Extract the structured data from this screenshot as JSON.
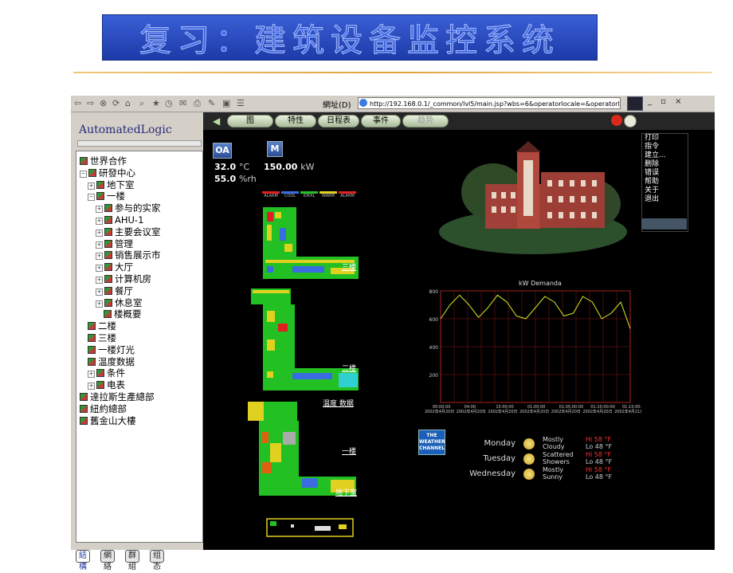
{
  "slide": {
    "title": "复习：建筑设备监控系统"
  },
  "browser": {
    "address_label": "網址(D)",
    "url": "http://192.168.0.1/_common/lvl5/main.jsp?wbs=6&operatorlocale=&operatorlanguage=ch",
    "window_controls": "_ ▫ ×"
  },
  "sidebar": {
    "logo": "AutomatedLogic",
    "tree": [
      {
        "label": "世界合作",
        "level": 0,
        "toggle": ""
      },
      {
        "label": "研發中心",
        "level": 0,
        "toggle": "−"
      },
      {
        "label": "地下室",
        "level": 1,
        "toggle": "+"
      },
      {
        "label": "一楼",
        "level": 1,
        "toggle": "−"
      },
      {
        "label": "参与的实家",
        "level": 2,
        "toggle": "+"
      },
      {
        "label": "AHU-1",
        "level": 2,
        "toggle": "+"
      },
      {
        "label": "主要会议室",
        "level": 2,
        "toggle": "+"
      },
      {
        "label": "管理",
        "level": 2,
        "toggle": "+"
      },
      {
        "label": "销售展示市",
        "level": 2,
        "toggle": "+"
      },
      {
        "label": "大厅",
        "level": 2,
        "toggle": "+"
      },
      {
        "label": "计算机房",
        "level": 2,
        "toggle": "+"
      },
      {
        "label": "餐厅",
        "level": 2,
        "toggle": "+"
      },
      {
        "label": "休息室",
        "level": 2,
        "toggle": "+"
      },
      {
        "label": "楼概要",
        "level": 3,
        "toggle": ""
      },
      {
        "label": "二楼",
        "level": 1,
        "toggle": ""
      },
      {
        "label": "三楼",
        "level": 1,
        "toggle": ""
      },
      {
        "label": "一楼灯光",
        "level": 1,
        "toggle": ""
      },
      {
        "label": "温度数据",
        "level": 1,
        "toggle": ""
      },
      {
        "label": "条件",
        "level": 1,
        "toggle": "+"
      },
      {
        "label": "电表",
        "level": 1,
        "toggle": "+"
      },
      {
        "label": "達拉斯生產總部",
        "level": 0,
        "toggle": ""
      },
      {
        "label": "紐約總部",
        "level": 0,
        "toggle": ""
      },
      {
        "label": "舊金山大樓",
        "level": 0,
        "toggle": ""
      }
    ],
    "tabs": [
      "結構",
      "網絡",
      "群組",
      "组态"
    ]
  },
  "navbar": {
    "buttons": [
      "图",
      "特性",
      "日程表",
      "事件",
      "趋势"
    ]
  },
  "menu": {
    "items": [
      "打印",
      "指令",
      "建立...",
      "删除",
      "错误",
      "帮助",
      "关于",
      "退出"
    ]
  },
  "readouts": {
    "oa_label": "OA",
    "m_label": "M",
    "temp_value": "32.0",
    "temp_unit": "°C",
    "kw_value": "150.00",
    "kw_unit": "kW",
    "rh_value": "55.0",
    "rh_unit": "%rh"
  },
  "legend": [
    "ALARM",
    "COOL",
    "IDEAL",
    "WARM",
    "ALARM"
  ],
  "legend_colors": [
    "#e02020",
    "#3a6be0",
    "#22c022",
    "#e0d020",
    "#e02020"
  ],
  "floors": {
    "third": "三楼",
    "second": "二楼",
    "first_data": "温度 数据",
    "first": "一楼",
    "basement": "地下室"
  },
  "chart_data": {
    "type": "line",
    "title": "kW Demanda",
    "yticks": [
      200,
      400,
      600,
      800
    ],
    "ylim": [
      0,
      800
    ],
    "x_tick_labels": [
      "00:00:00",
      "04:00",
      "15:00:00",
      "01:00:00",
      "01:05:00:00",
      "01:10:00:00",
      "01:15:00:00"
    ],
    "x_date_labels": [
      "2002年4月20日",
      "2002年4月20日",
      "2002年4月20日",
      "2002年4月20日",
      "2002年4月20日",
      "2002年4月20日",
      "2002年4月21日"
    ],
    "series": [
      {
        "color": "#d8f020",
        "x": [
          0,
          0.05,
          0.1,
          0.15,
          0.2,
          0.25,
          0.3,
          0.35,
          0.4,
          0.45,
          0.5,
          0.55,
          0.6,
          0.65,
          0.7,
          0.75,
          0.8,
          0.85,
          0.9,
          0.95,
          1.0
        ],
        "values": [
          600,
          700,
          770,
          700,
          610,
          680,
          770,
          720,
          620,
          600,
          680,
          760,
          720,
          620,
          640,
          760,
          720,
          600,
          640,
          720,
          530
        ]
      }
    ]
  },
  "weather": {
    "logo": [
      "THE",
      "WEATHER",
      "CHANNEL"
    ],
    "days": [
      {
        "day": "Monday",
        "cond1": "Mostly",
        "cond2": "Cloudy",
        "hi": "Hi 58 °F",
        "lo": "Lo 48 °F"
      },
      {
        "day": "Tuesday",
        "cond1": "Scattered",
        "cond2": "Showers",
        "hi": "Hi 58 °F",
        "lo": "Lo 48 °F"
      },
      {
        "day": "Wednesday",
        "cond1": "Mostly",
        "cond2": "Sunny",
        "hi": "Hi 58 °F",
        "lo": "Lo 48 °F"
      }
    ]
  },
  "colors": {
    "accent_hi": "#ff3030",
    "chart_line": "#d8f020"
  }
}
